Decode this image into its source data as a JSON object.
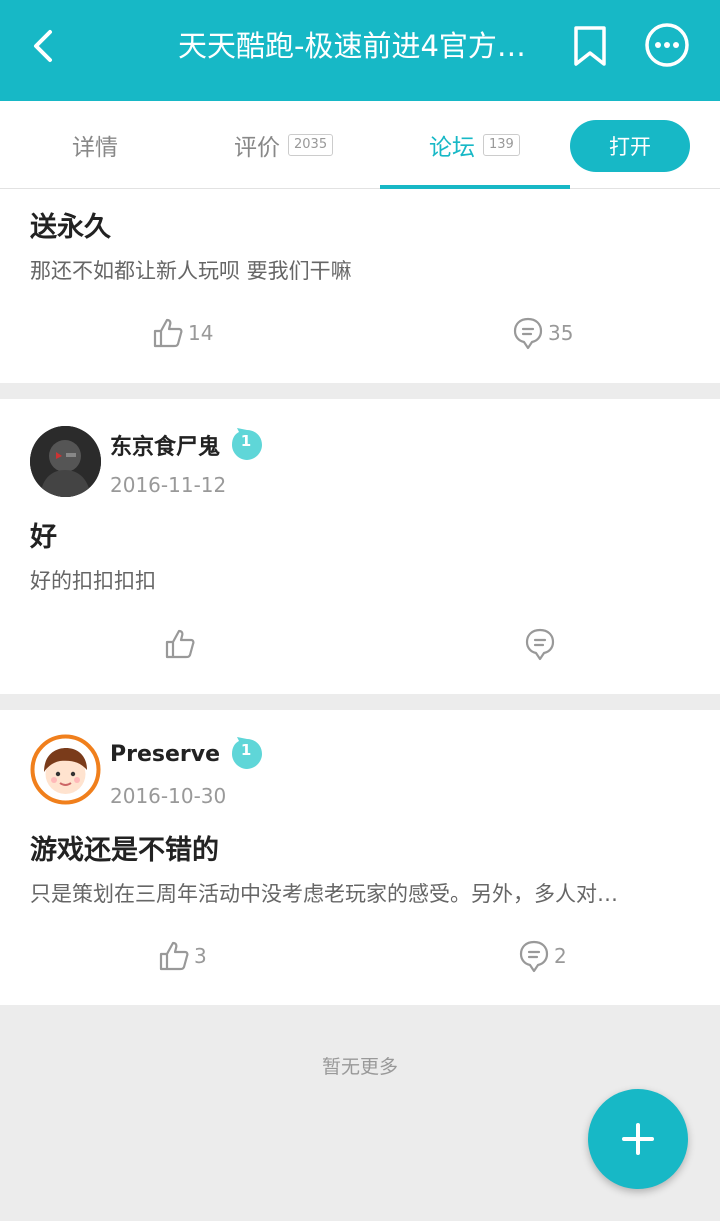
{
  "header": {
    "title": "天天酷跑-极速前进4官方…"
  },
  "tabs": [
    {
      "label": "详情",
      "count": ""
    },
    {
      "label": "评价",
      "count": "2035"
    },
    {
      "label": "论坛",
      "count": "139"
    }
  ],
  "open_button": "打开",
  "posts": [
    {
      "title": "送永久",
      "body": "那还不如都让新人玩呗 要我们干嘛",
      "likes": "14",
      "comments": "35"
    },
    {
      "author": "东京食尸鬼",
      "level": "1",
      "date": "2016-11-12",
      "title": "好",
      "body": "好的扣扣扣扣",
      "likes": "",
      "comments": ""
    },
    {
      "author": "Preserve",
      "level": "1",
      "date": "2016-10-30",
      "title": "游戏还是不错的",
      "body": "只是策划在三周年活动中没考虑老玩家的感受。另外，多人对…",
      "likes": "3",
      "comments": "2"
    }
  ],
  "footer": "暂无更多",
  "colors": {
    "accent": "#17b8c6",
    "badge": "#5fd6d8"
  }
}
